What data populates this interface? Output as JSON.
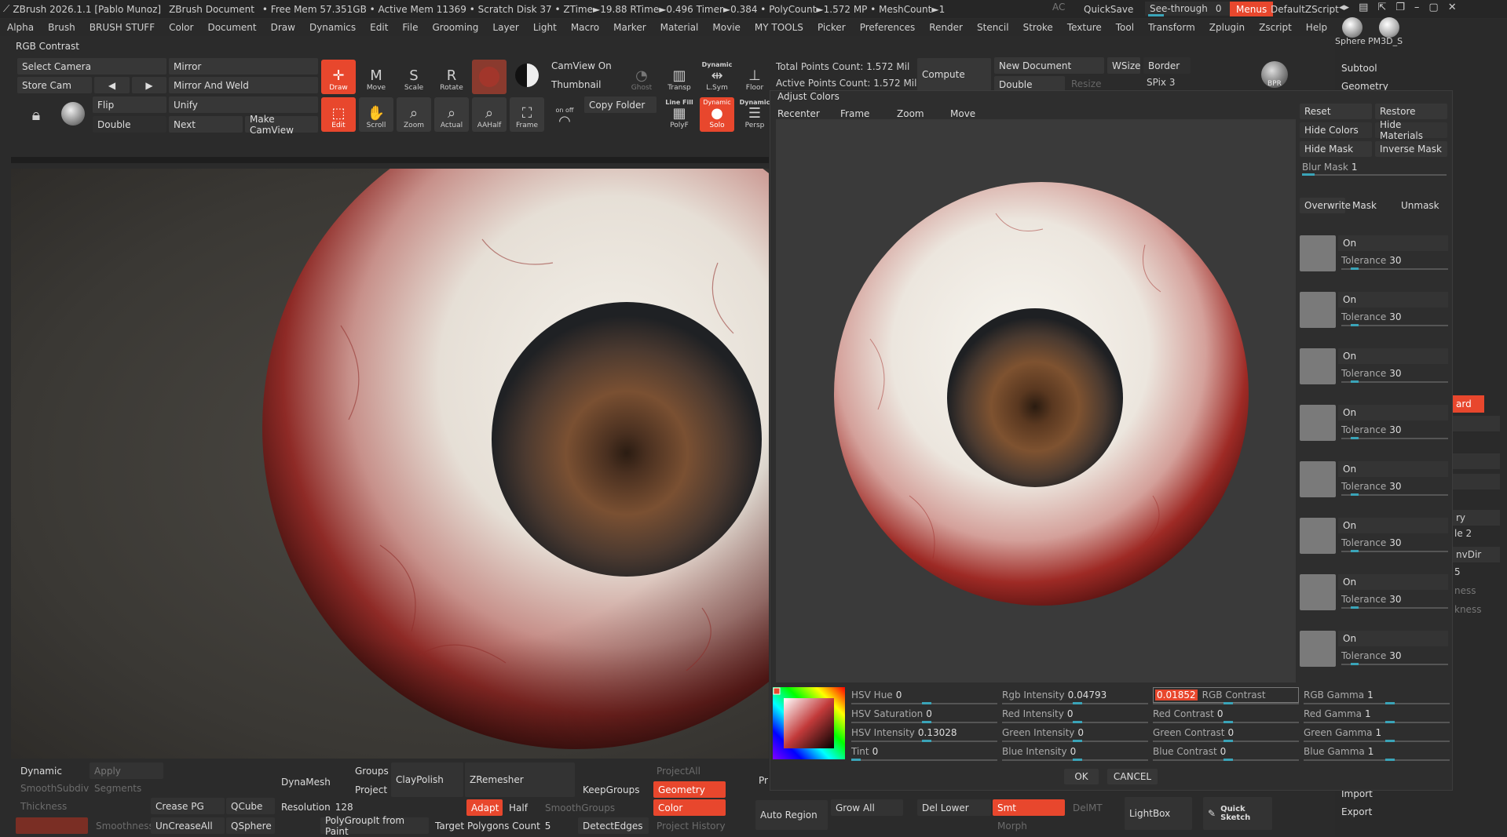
{
  "titlebar": {
    "app": "ZBrush 2026.1.1 [Pablo Munoz]",
    "doc": "ZBrush Document",
    "stats": "• Free Mem 57.351GB • Active Mem 11369 • Scratch Disk 37 • ZTime►19.88 RTime►0.496 Timer►0.384 • PolyCount►1.572 MP • MeshCount►1",
    "ac": "AC",
    "quicksave": "QuickSave",
    "seethrough": "See-through",
    "seethrough_value": "0",
    "menus": "Menus",
    "script": "DefaultZScript"
  },
  "menus": [
    "Alpha",
    "Brush",
    "BRUSH STUFF",
    "Color",
    "Document",
    "Draw",
    "Dynamics",
    "Edit",
    "File",
    "Grooming",
    "Layer",
    "Light",
    "Macro",
    "Marker",
    "Material",
    "Movie",
    "MY TOOLS",
    "Picker",
    "Preferences",
    "Render",
    "Stencil",
    "Stroke",
    "Texture",
    "Tool",
    "Transform",
    "Zplugin",
    "Zscript",
    "Help"
  ],
  "subtitle": "RGB Contrast",
  "toolbar": {
    "select_camera": "Select Camera",
    "store_cam": "Store Cam",
    "mirror": "Mirror",
    "mirror_weld": "Mirror And Weld",
    "flip": "Flip",
    "unify": "Unify",
    "double": "Double",
    "next": "Next",
    "make_camview": "Make CamView",
    "draw": "Draw",
    "move": "Move",
    "scale": "Scale",
    "rotate": "Rotate",
    "edit": "Edit",
    "scroll": "Scroll",
    "zoom": "Zoom",
    "actual": "Actual",
    "aahalf": "AAHalf",
    "frame": "Frame",
    "camview_on": "CamView On",
    "thumbnail": "Thumbnail",
    "copy_folder": "Copy Folder",
    "ghost": "Ghost",
    "transp": "Transp",
    "lsym": "L.Sym",
    "dynamic": "Dynamic",
    "floor": "Floor",
    "linefill": "Line Fill",
    "polyf": "PolyF",
    "solo": "Solo",
    "persp": "Persp",
    "dynamic2": "Dynamic",
    "onoff": "on off"
  },
  "stats": {
    "total_points": "Total Points Count: 1.572 Mil",
    "active_points": "Active Points Count: 1.572 Mil",
    "compute": "Compute",
    "new_document": "New Document",
    "wsize": "WSize",
    "border": "Border",
    "double": "Double",
    "resize": "Resize",
    "spix": "SPix 3",
    "bpr": "BPR"
  },
  "dialog": {
    "title": "Adjust Colors",
    "recenter": "Recenter",
    "frame": "Frame",
    "zoom": "Zoom",
    "move": "Move",
    "reset": "Reset",
    "restore": "Restore",
    "hide_colors": "Hide Colors",
    "hide_materials": "Hide Materials",
    "hide_mask": "Hide Mask",
    "inverse_mask": "Inverse Mask",
    "blur_mask": "Blur Mask",
    "blur_mask_value": "1",
    "overwrite": "Overwrite",
    "mask": "Mask",
    "unmask": "Unmask",
    "swatches": [
      {
        "on": "On",
        "tol": "Tolerance",
        "val": "30"
      },
      {
        "on": "On",
        "tol": "Tolerance",
        "val": "30"
      },
      {
        "on": "On",
        "tol": "Tolerance",
        "val": "30"
      },
      {
        "on": "On",
        "tol": "Tolerance",
        "val": "30"
      },
      {
        "on": "On",
        "tol": "Tolerance",
        "val": "30"
      },
      {
        "on": "On",
        "tol": "Tolerance",
        "val": "30"
      },
      {
        "on": "On",
        "tol": "Tolerance",
        "val": "30"
      },
      {
        "on": "On",
        "tol": "Tolerance",
        "val": "30"
      }
    ],
    "sliders": {
      "hsv_hue": {
        "label": "HSV Hue",
        "value": "0"
      },
      "hsv_saturation": {
        "label": "HSV Saturation",
        "value": "0"
      },
      "hsv_intensity": {
        "label": "HSV Intensity",
        "value": "0.13028"
      },
      "tint": {
        "label": "Tint",
        "value": "0"
      },
      "rgb_intensity": {
        "label": "Rgb Intensity",
        "value": "0.04793"
      },
      "red_intensity": {
        "label": "Red Intensity",
        "value": "0"
      },
      "green_intensity": {
        "label": "Green Intensity",
        "value": "0"
      },
      "blue_intensity": {
        "label": "Blue Intensity",
        "value": "0"
      },
      "rgb_contrast": {
        "label": "RGB Contrast",
        "value": "0.01852"
      },
      "red_contrast": {
        "label": "Red Contrast",
        "value": "0"
      },
      "green_contrast": {
        "label": "Green Contrast",
        "value": "0"
      },
      "blue_contrast": {
        "label": "Blue Contrast",
        "value": "0"
      },
      "rgb_gamma": {
        "label": "RGB Gamma",
        "value": "1"
      },
      "red_gamma": {
        "label": "Red Gamma",
        "value": "1"
      },
      "green_gamma": {
        "label": "Green Gamma",
        "value": "1"
      },
      "blue_gamma": {
        "label": "Blue Gamma",
        "value": "1"
      }
    },
    "ok": "OK",
    "cancel": "CANCEL"
  },
  "bottom": {
    "dynamic": "Dynamic",
    "apply": "Apply",
    "smoothsubdiv": "SmoothSubdiv",
    "segments": "Segments",
    "thickness": "Thickness",
    "crease_pg": "Crease PG",
    "qcube": "QCube",
    "uncreaseall": "UnCreaseAll",
    "qsphere": "QSphere",
    "smoothness": "Smoothness",
    "dynamesh": "DynaMesh",
    "groups": "Groups",
    "project": "Project",
    "claypolish": "ClayPolish",
    "resolution": "Resolution",
    "resolution_value": "128",
    "polygroupit": "PolyGroupIt from Paint",
    "zremesher": "ZRemesher",
    "adapt": "Adapt",
    "half": "Half",
    "smoothgroups": "SmoothGroups",
    "target_poly": "Target Polygons Count",
    "target_poly_value": "5",
    "keepgroups": "KeepGroups",
    "projectall": "ProjectAll",
    "geometry": "Geometry",
    "color": "Color",
    "detectedges": "DetectEdges",
    "project_history": "Project History",
    "pr": "Pr",
    "auto_region": "Auto Region",
    "grow_all": "Grow All",
    "del_lower": "Del Lower",
    "smt": "Smt",
    "delmt": "DelMT",
    "morph": "Morph",
    "lightbox": "LightBox",
    "quick_sketch": "Quick Sketch"
  },
  "rightpanel": {
    "sphere": "Sphere",
    "pm3d": "PM3D_S",
    "subtool": "Subtool",
    "geometry": "Geometry",
    "partial": [
      "ard",
      "ry",
      "le 2",
      "nvDir",
      "5",
      "ness",
      "kness"
    ],
    "import": "Import",
    "export": "Export"
  },
  "colors": {
    "accent": "#e8472d",
    "slider": "#3aa4b8"
  }
}
